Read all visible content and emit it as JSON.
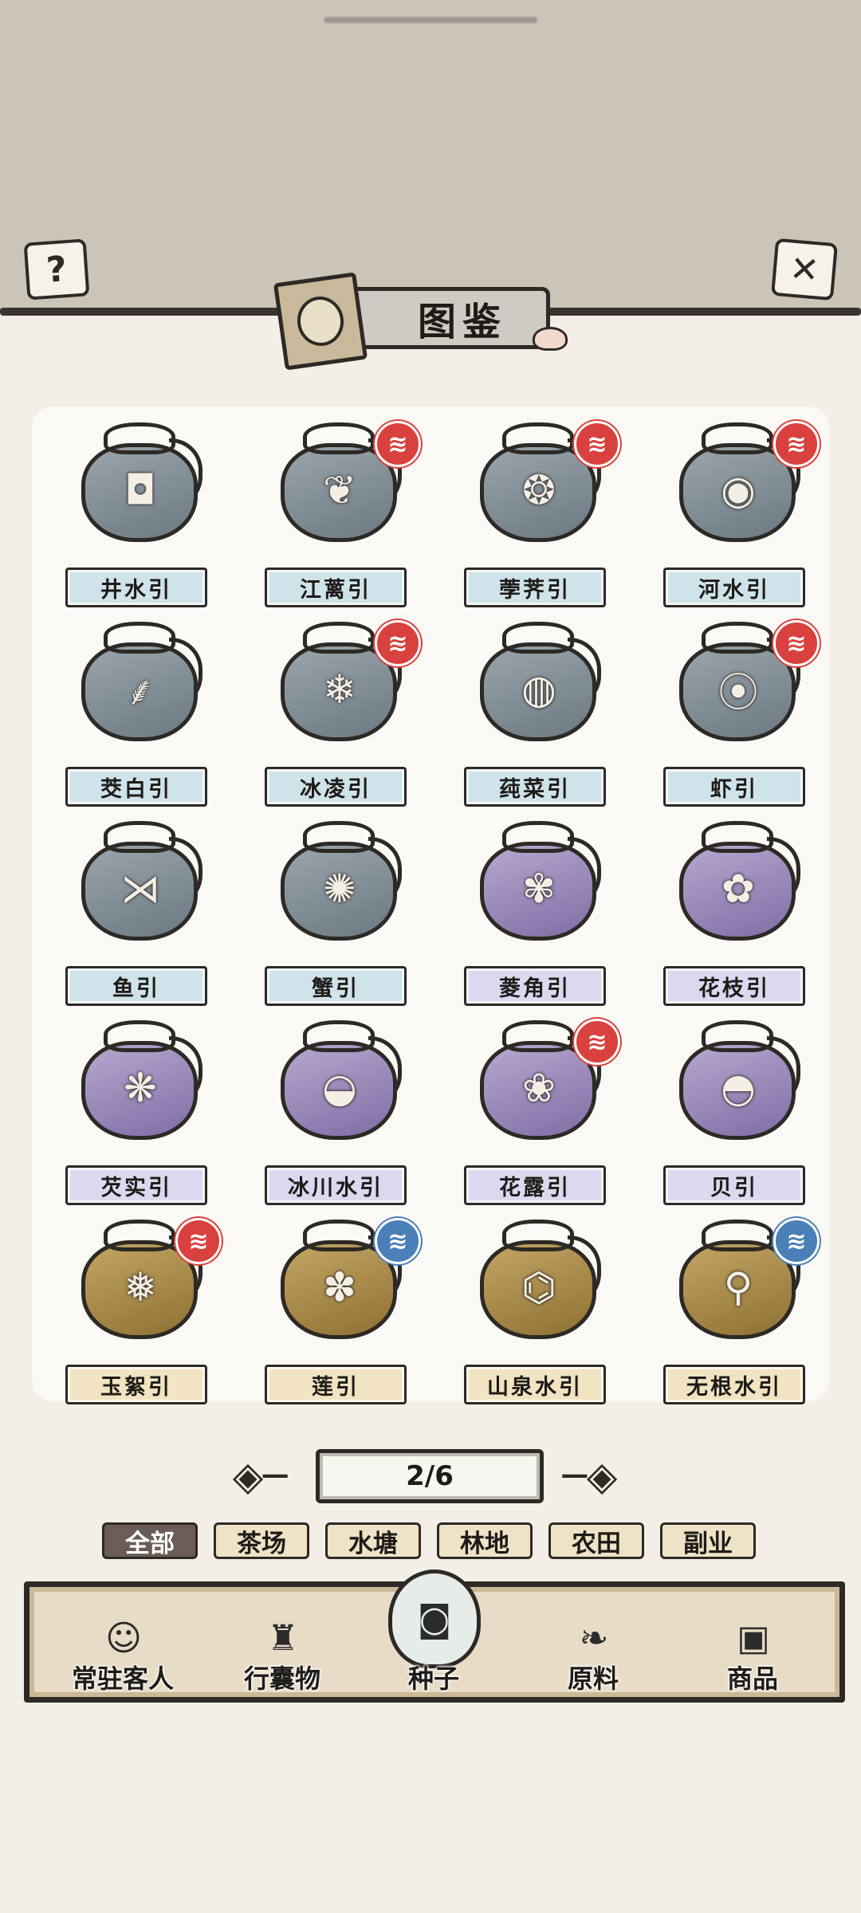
{
  "header": {
    "title": "图鉴",
    "help_icon": "question-mark-icon",
    "close_icon": "close-x-icon"
  },
  "items": [
    {
      "label": "井水引",
      "icon": "wooden-bucket-icon",
      "glyph": "◘",
      "tier": "gray",
      "stamp": ""
    },
    {
      "label": "江蓠引",
      "icon": "seaweed-twig-icon",
      "glyph": "❦",
      "tier": "gray",
      "stamp": "red"
    },
    {
      "label": "荸荠引",
      "icon": "water-chestnut-icon",
      "glyph": "❂",
      "tier": "gray",
      "stamp": "red"
    },
    {
      "label": "河水引",
      "icon": "water-ladle-icon",
      "glyph": "◉",
      "tier": "gray",
      "stamp": "red"
    },
    {
      "label": "茭白引",
      "icon": "wild-rice-stem-icon",
      "glyph": "⸙",
      "tier": "gray",
      "stamp": ""
    },
    {
      "label": "冰凌引",
      "icon": "icicle-icon",
      "glyph": "❄",
      "tier": "gray",
      "stamp": "red"
    },
    {
      "label": "莼菜引",
      "icon": "water-shield-bowl-icon",
      "glyph": "◍",
      "tier": "gray",
      "stamp": ""
    },
    {
      "label": "虾引",
      "icon": "shrimp-icon",
      "glyph": "⦿",
      "tier": "gray",
      "stamp": "red"
    },
    {
      "label": "鱼引",
      "icon": "fish-icon",
      "glyph": "⋊",
      "tier": "gray",
      "stamp": ""
    },
    {
      "label": "蟹引",
      "icon": "crab-icon",
      "glyph": "✺",
      "tier": "gray",
      "stamp": ""
    },
    {
      "label": "菱角引",
      "icon": "water-caltrop-icon",
      "glyph": "✾",
      "tier": "purple",
      "stamp": ""
    },
    {
      "label": "花枝引",
      "icon": "cuttlefish-icon",
      "glyph": "✿",
      "tier": "purple",
      "stamp": ""
    },
    {
      "label": "芡实引",
      "icon": "foxnut-icon",
      "glyph": "❋",
      "tier": "purple",
      "stamp": ""
    },
    {
      "label": "冰川水引",
      "icon": "glacier-water-bowl-icon",
      "glyph": "◒",
      "tier": "purple",
      "stamp": ""
    },
    {
      "label": "花露引",
      "icon": "flower-dew-icon",
      "glyph": "❀",
      "tier": "purple",
      "stamp": "red"
    },
    {
      "label": "贝引",
      "icon": "scallop-shell-icon",
      "glyph": "◓",
      "tier": "purple",
      "stamp": ""
    },
    {
      "label": "玉絮引",
      "icon": "snowflake-icon",
      "glyph": "❅",
      "tier": "gold",
      "stamp": "red"
    },
    {
      "label": "莲引",
      "icon": "lotus-icon",
      "glyph": "✽",
      "tier": "gold",
      "stamp": "blue"
    },
    {
      "label": "山泉水引",
      "icon": "spring-water-tube-icon",
      "glyph": "⌬",
      "tier": "gold",
      "stamp": ""
    },
    {
      "label": "无根水引",
      "icon": "rainwater-jar-icon",
      "glyph": "⚲",
      "tier": "gold",
      "stamp": "blue"
    }
  ],
  "pager": {
    "value": "2/6",
    "prev_icon": "ornate-left-arrow-icon",
    "next_icon": "ornate-right-arrow-icon"
  },
  "filters": [
    {
      "label": "全部",
      "active": true
    },
    {
      "label": "茶场",
      "active": false
    },
    {
      "label": "水塘",
      "active": false
    },
    {
      "label": "林地",
      "active": false
    },
    {
      "label": "农田",
      "active": false
    },
    {
      "label": "副业",
      "active": false
    }
  ],
  "tabs": [
    {
      "label": "常驻客人",
      "icon": "guest-girl-icon",
      "glyph": "☺",
      "active": false
    },
    {
      "label": "行囊物",
      "icon": "robe-icon",
      "glyph": "♜",
      "active": false
    },
    {
      "label": "种子",
      "icon": "seed-bag-icon",
      "glyph": "◙",
      "active": true
    },
    {
      "label": "原料",
      "icon": "leaf-icon",
      "glyph": "❧",
      "active": false
    },
    {
      "label": "商品",
      "icon": "gift-box-icon",
      "glyph": "▣",
      "active": false
    }
  ],
  "colors": {
    "top_band": "#cdc4b8",
    "page_bg": "#f3efe6",
    "active_filter": "#6b5c58",
    "stamp_red": "#d8413d",
    "stamp_blue": "#4a7fb8"
  }
}
